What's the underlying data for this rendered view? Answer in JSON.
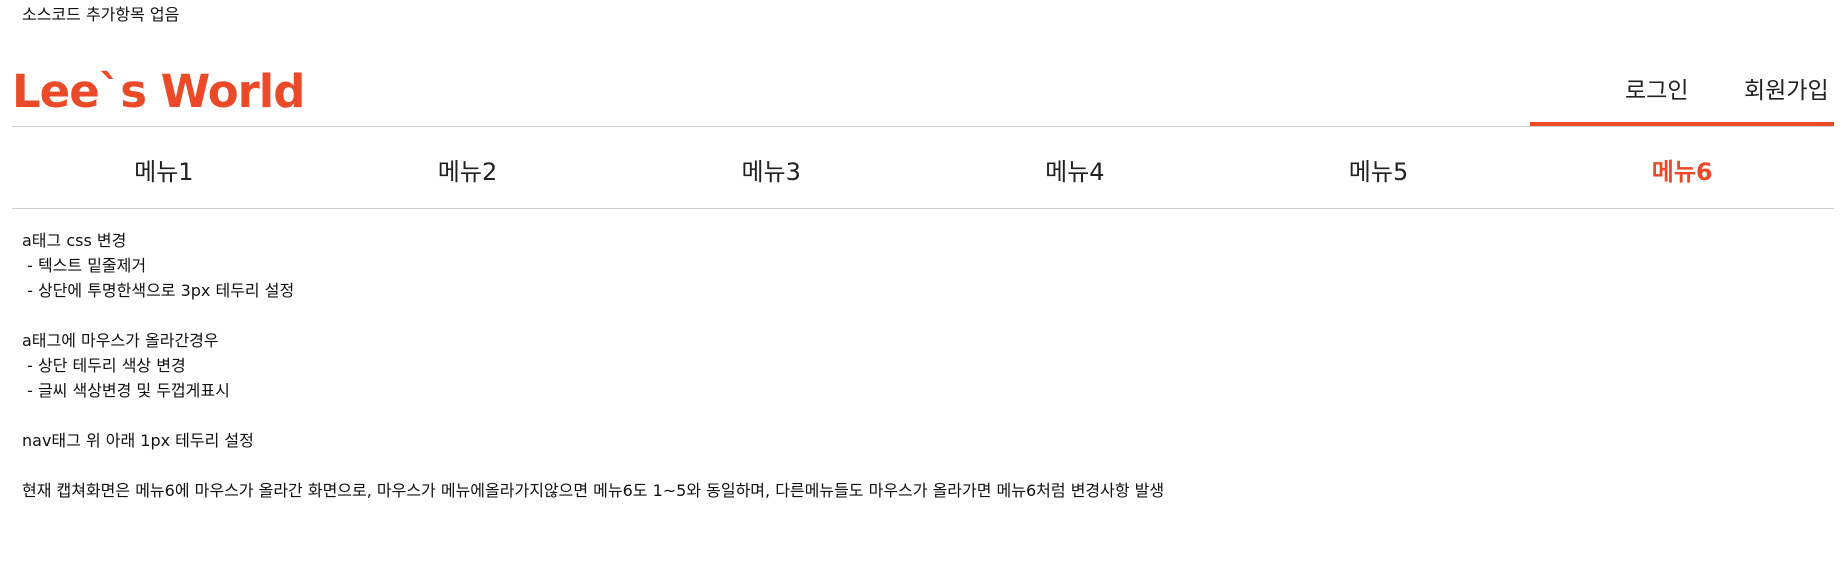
{
  "top_note": "소스코드 추가항목 업음",
  "header": {
    "logo": "Lee`s World",
    "login": "로그인",
    "signup": "회원가입"
  },
  "nav": {
    "items": [
      "메뉴1",
      "메뉴2",
      "메뉴3",
      "메뉴4",
      "메뉴5",
      "메뉴6"
    ],
    "active_index": 5
  },
  "notes": {
    "a_css_title": "a태그 css 변경",
    "a_css_1": " - 텍스트 밑줄제거",
    "a_css_2": " - 상단에 투명한색으로 3px 테두리 설정",
    "a_hover_title": "a태그에 마우스가 올라간경우",
    "a_hover_1": " - 상단 테두리 색상 변경",
    "a_hover_2": " - 글씨 색상변경 및 두껍게표시",
    "nav_border": "nav태그 위 아래 1px 테두리 설정",
    "caption": "현재 캡쳐화면은 메뉴6에 마우스가 올라간 화면으로, 마우스가 메뉴에올라가지않으면 메뉴6도 1~5와 동일하며, 다른메뉴들도 마우스가 올라가면 메뉴6처럼 변경사항 발생"
  },
  "colors": {
    "accent": "#ea4a28",
    "border": "#cfcfcf",
    "text": "#222222"
  }
}
